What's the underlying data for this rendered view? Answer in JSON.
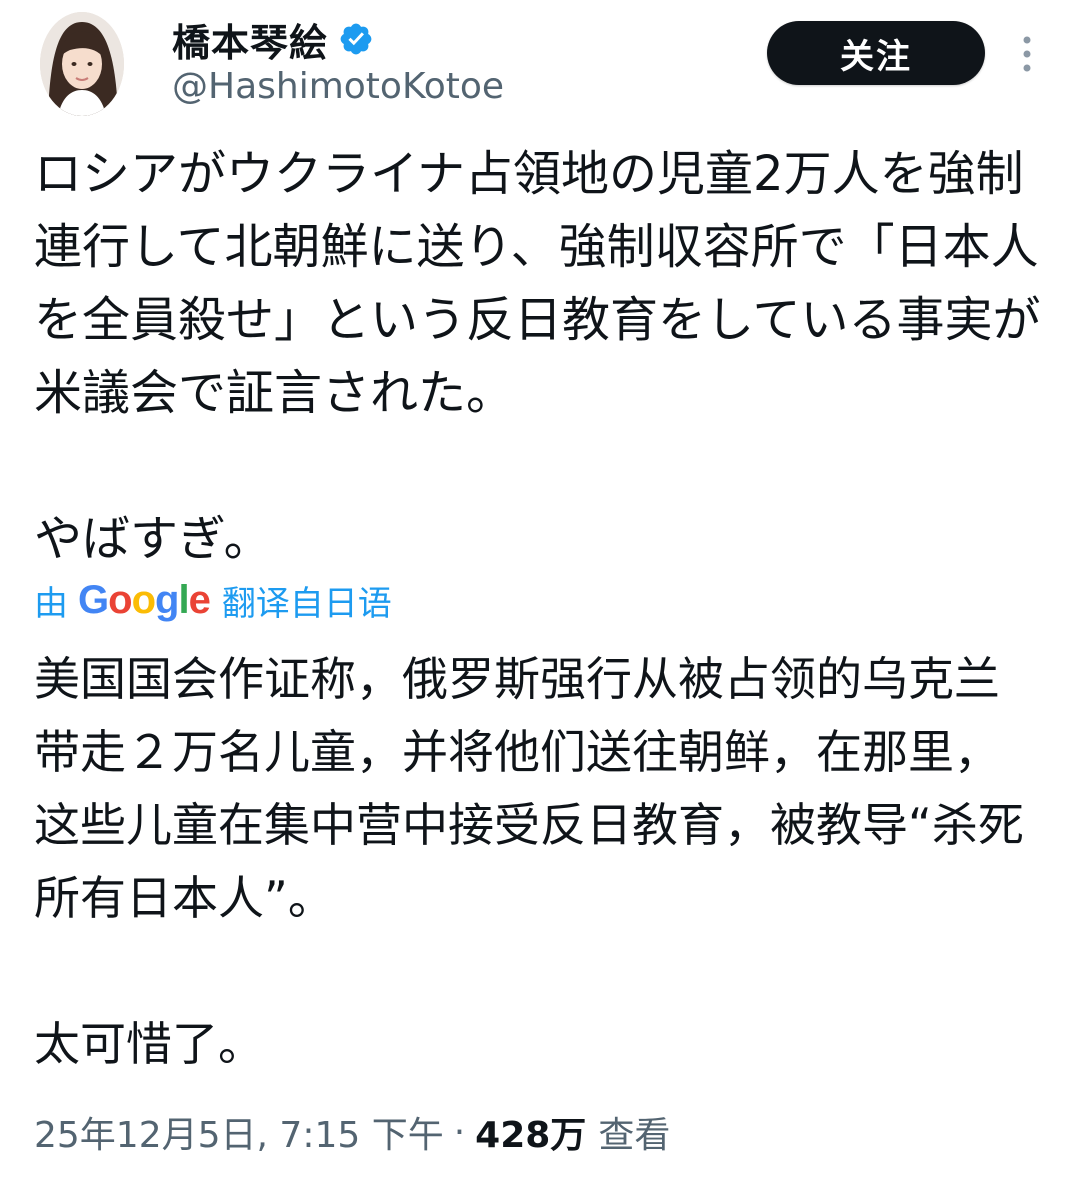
{
  "author": {
    "display_name": "橋本琴絵",
    "handle": "@HashimotoKotoe",
    "verified_icon": "verified-badge-icon",
    "avatar_icon": "profile-avatar"
  },
  "actions": {
    "follow_label": "关注",
    "more_icon": "more-vertical-icon"
  },
  "tweet": {
    "original_text": "ロシアがウクライナ占領地の児童2万人を強制連行して北朝鮮に送り、強制収容所で「日本人を全員殺せ」という反日教育をしている事実が米議会で証言された。\n\nやばすぎ。",
    "translation_prefix": "由",
    "translation_provider": "Google",
    "translation_suffix": "翻译自日语",
    "translated_text": "美国国会作证称，俄罗斯强行从被占领的乌克兰带走２万名儿童，并将他们送往朝鲜，在那里，这些儿童在集中营中接受反日教育，被教导“杀死所有日本人”。\n\n太可惜了。"
  },
  "meta": {
    "timestamp": "25年12月5日, 7:15 下午",
    "separator": "·",
    "views_count": "428万",
    "views_label": "查看"
  },
  "colors": {
    "text": "#0f1419",
    "secondary": "#536471",
    "link": "#1d9bf0",
    "verified": "#1d9bf0",
    "button_bg": "#0f1419"
  }
}
